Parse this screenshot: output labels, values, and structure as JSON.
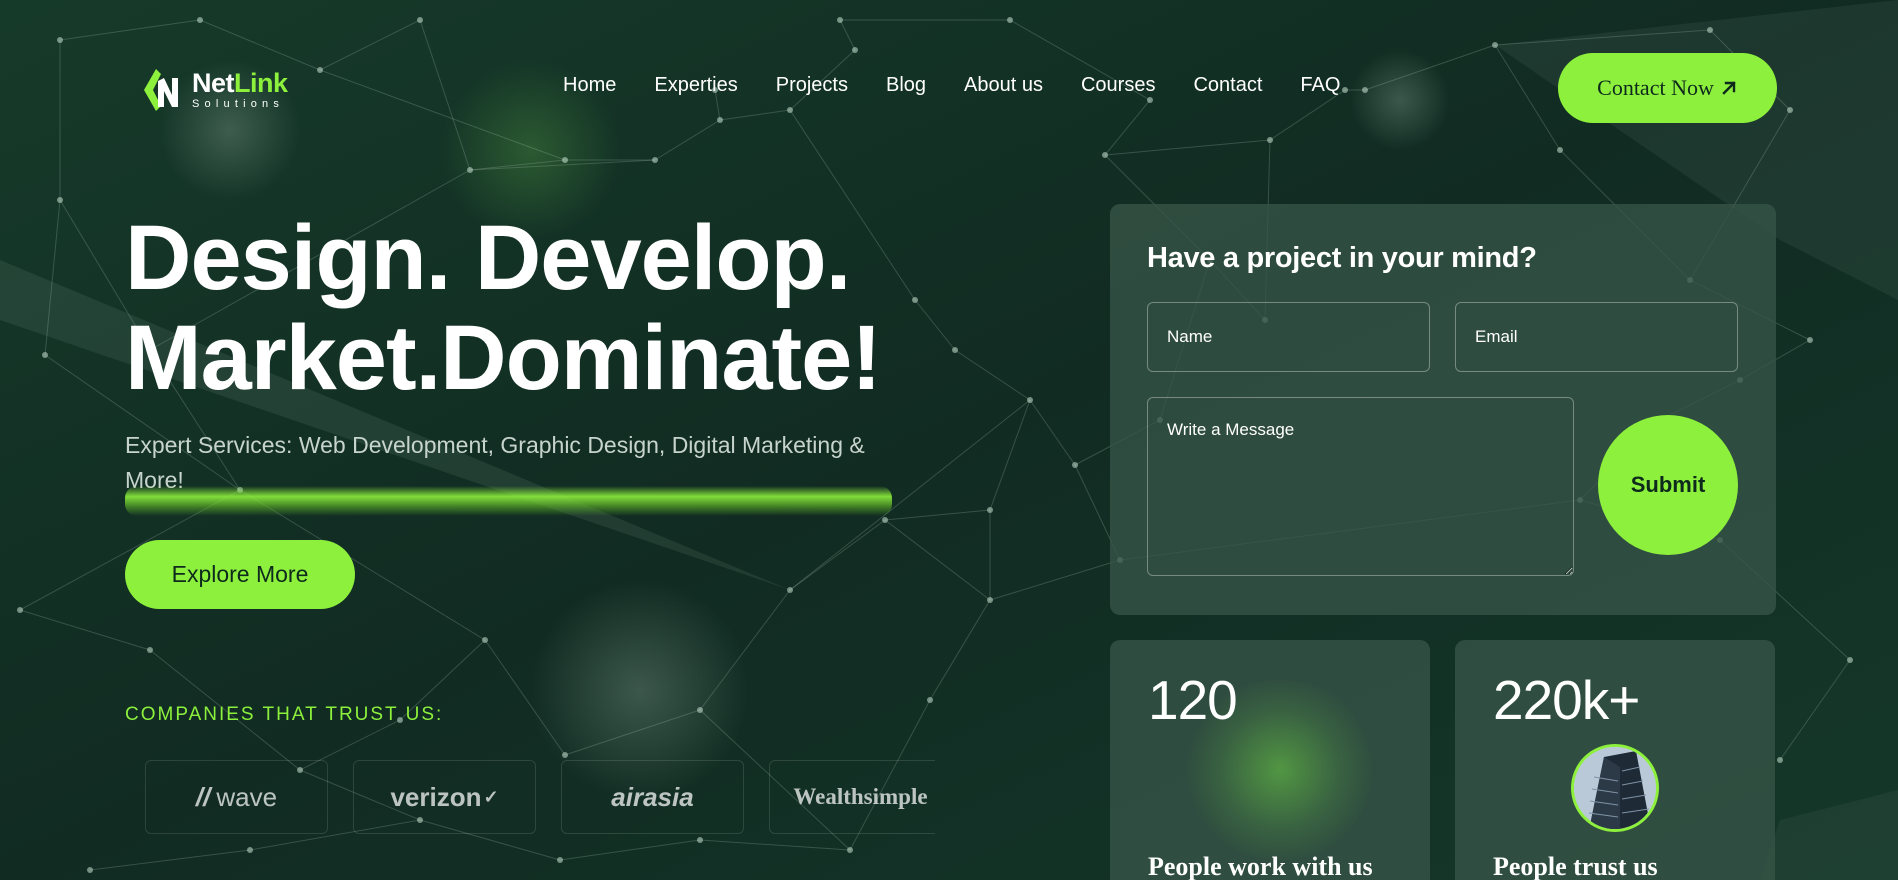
{
  "brand": {
    "name_part1": "Net",
    "name_part2": "Link",
    "tagline": "Solutions"
  },
  "nav": {
    "items": [
      {
        "label": "Home"
      },
      {
        "label": "Experties"
      },
      {
        "label": "Projects"
      },
      {
        "label": "Blog"
      },
      {
        "label": "About us"
      },
      {
        "label": "Courses"
      },
      {
        "label": "Contact"
      },
      {
        "label": "FAQ"
      }
    ],
    "cta_label": "Contact Now"
  },
  "hero": {
    "title_line1": "Design. Develop.",
    "title_line2": "Market.Dominate!",
    "subtitle": "Expert Services: Web Development, Graphic Design, Digital Marketing & More!",
    "cta_label": "Explore More"
  },
  "trust": {
    "title": "COMPANIES THAT TRUST US:",
    "companies": [
      "wave",
      "verizon",
      "airasia",
      "Wealthsimple"
    ]
  },
  "form": {
    "title": "Have a project in your mind?",
    "name_placeholder": "Name",
    "email_placeholder": "Email",
    "message_placeholder": "Write a Message",
    "submit_label": "Submit"
  },
  "stats": [
    {
      "number": "120",
      "label": "People work with us"
    },
    {
      "number": "220k+",
      "label": "People trust us"
    }
  ],
  "colors": {
    "background": "#123026",
    "accent": "#8df03c",
    "card": "#375548"
  }
}
